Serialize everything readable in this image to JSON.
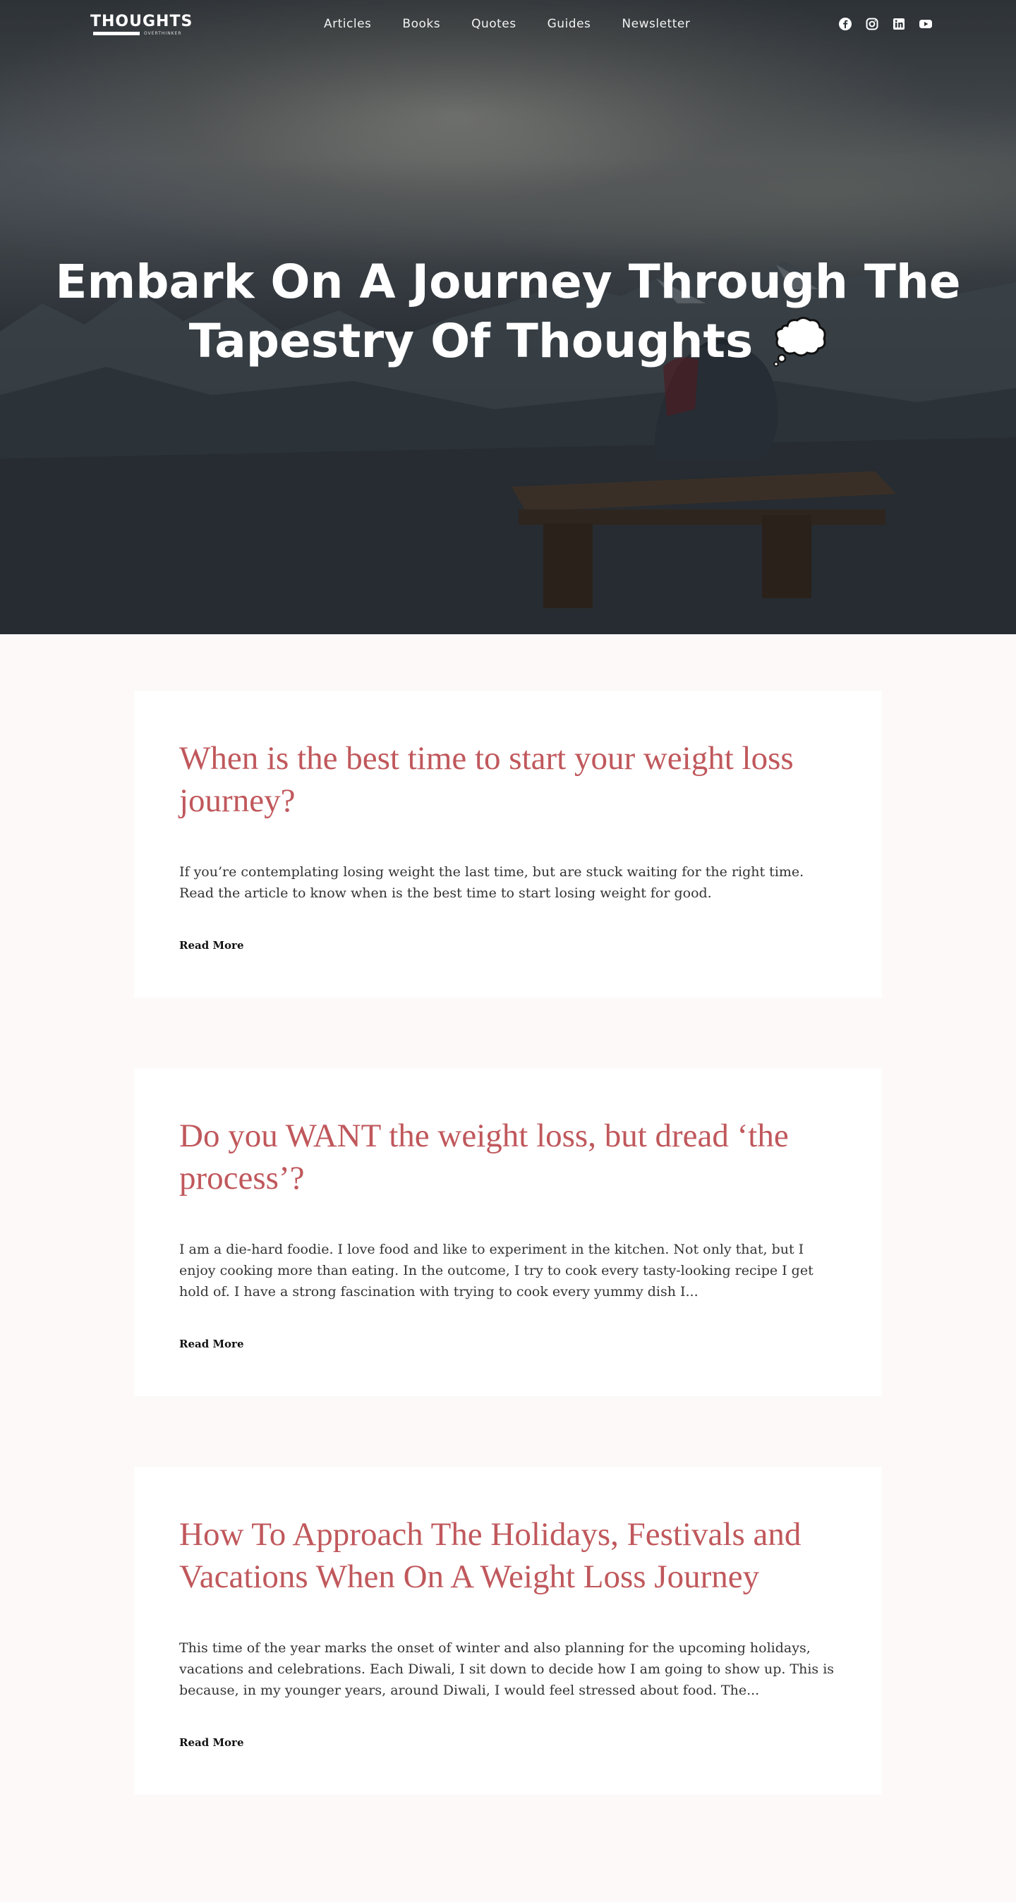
{
  "nav": {
    "logo_word": "THOUGHTS",
    "logo_sub": "OVERTHINKER",
    "menu": [
      "Articles",
      "Books",
      "Quotes",
      "Guides",
      "Newsletter"
    ],
    "social_icons": [
      "facebook-icon",
      "instagram-icon",
      "linkedin-icon",
      "youtube-icon"
    ]
  },
  "hero": {
    "title_line1": "Embark On A Journey Through The",
    "title_line2": "Tapestry Of Thoughts",
    "title_icon": "thought-balloon-icon"
  },
  "articles": [
    {
      "title": "When is the best time to start your weight loss journey?",
      "excerpt": "If you’re contemplating losing weight the last time, but are stuck waiting for the right time. Read the article to know when is the best time to start losing weight for good.",
      "read_more": "Read More"
    },
    {
      "title": "Do you WANT the weight loss, but dread ‘the process’?",
      "excerpt": "I am a die-hard foodie. I love food and like to experiment in the kitchen. Not only that, but I enjoy cooking more than eating. In the outcome, I try to cook every tasty-looking recipe I get hold of. I have a strong fascination with trying to cook every yummy dish I...",
      "read_more": "Read More"
    },
    {
      "title": "How To Approach The Holidays, Festivals and Vacations When On A Weight Loss Journey",
      "excerpt": "This time of the year marks the onset of winter and also planning for the upcoming holidays, vacations and celebrations. Each Diwali, I sit down to decide how I am going to show up. This is because, in my younger years, around Diwali, I would feel stressed about food. The...",
      "read_more": "Read More"
    }
  ],
  "colors": {
    "accent": "#c0585c",
    "page_bg": "#fcf9f8",
    "card_bg": "#ffffff"
  }
}
